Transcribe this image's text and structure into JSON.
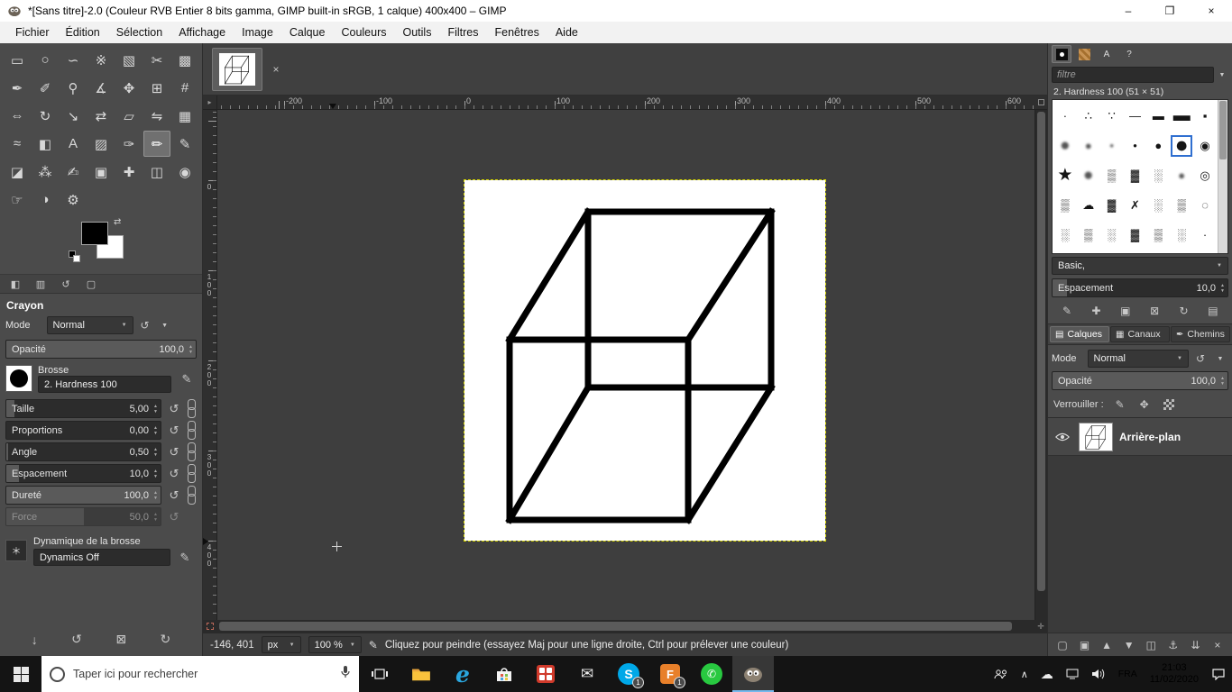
{
  "colors": {
    "selection_accent": "#2f6fd0",
    "layer_boundary_yellow": "#d8d800",
    "canvas_bg": "#ffffff",
    "foreground_color": "#000000",
    "background_color": "#ffffff"
  },
  "icons": {
    "caret_down": "▼",
    "spin_up": "▲",
    "spin_down": "▼",
    "reset": "↺",
    "close": "×",
    "edit": "✎",
    "menu_arrow": "▸",
    "swap": "⇄",
    "corner_menu": "≡",
    "nav_cross": "✛",
    "lock_pixels": "✎",
    "lock_position": "✥",
    "dynamics": "＊",
    "status_tool": "✎",
    "chevron_up": "∧",
    "cloud": "☁",
    "mail": "✉",
    "phone": "✆"
  },
  "window": {
    "title": "*[Sans titre]-2.0 (Couleur RVB Entier 8 bits gamma, GIMP built-in sRGB, 1 calque) 400x400 – GIMP",
    "controls": {
      "minimize": "–",
      "maximize": "❐",
      "close": "×"
    }
  },
  "menu": {
    "items": [
      "Fichier",
      "Édition",
      "Sélection",
      "Affichage",
      "Image",
      "Calque",
      "Couleurs",
      "Outils",
      "Filtres",
      "Fenêtres",
      "Aide"
    ]
  },
  "toolbox": {
    "tools": [
      {
        "n": "rectangle-select-tool",
        "g": "▭"
      },
      {
        "n": "ellipse-select-tool",
        "g": "○"
      },
      {
        "n": "free-select-tool",
        "g": "∽"
      },
      {
        "n": "fuzzy-select-tool",
        "g": "※"
      },
      {
        "n": "select-by-color-tool",
        "g": "▧"
      },
      {
        "n": "scissors-select-tool",
        "g": "✂"
      },
      {
        "n": "foreground-select-tool",
        "g": "▩"
      },
      {
        "n": "paths-tool",
        "g": "✒"
      },
      {
        "n": "color-picker-tool",
        "g": "✐"
      },
      {
        "n": "zoom-tool",
        "g": "⚲"
      },
      {
        "n": "measure-tool",
        "g": "∡"
      },
      {
        "n": "move-tool",
        "g": "✥"
      },
      {
        "n": "align-tool",
        "g": "⊞"
      },
      {
        "n": "crop-tool",
        "g": "#"
      },
      {
        "n": "unified-transform-tool",
        "g": "⇔"
      },
      {
        "n": "rotate-tool",
        "g": "↻"
      },
      {
        "n": "scale-tool",
        "g": "↘"
      },
      {
        "n": "shear-tool",
        "g": "⇄"
      },
      {
        "n": "perspective-tool",
        "g": "▱"
      },
      {
        "n": "flip-tool",
        "g": "⇋"
      },
      {
        "n": "cage-transform-tool",
        "g": "▦"
      },
      {
        "n": "warp-transform-tool",
        "g": "≈"
      },
      {
        "n": "bucket-fill-tool",
        "g": "◧"
      },
      {
        "n": "text-tool",
        "g": "A"
      },
      {
        "n": "gradient-tool",
        "g": "▨"
      },
      {
        "n": "ink-tool",
        "g": "✑"
      },
      {
        "n": "pencil-tool",
        "g": "✏",
        "sel": "sel"
      },
      {
        "n": "paintbrush-tool",
        "g": "✎"
      },
      {
        "n": "eraser-tool",
        "g": "◪"
      },
      {
        "n": "airbrush-tool",
        "g": "⁂"
      },
      {
        "n": "mypaint-brush-tool",
        "g": "✍"
      },
      {
        "n": "clone-tool",
        "g": "▣"
      },
      {
        "n": "heal-tool",
        "g": "✚"
      },
      {
        "n": "perspective-clone-tool",
        "g": "◫"
      },
      {
        "n": "blur-sharpen-tool",
        "g": "◉"
      },
      {
        "n": "smudge-tool",
        "g": "☞"
      },
      {
        "n": "dodge-burn-tool",
        "g": "◑"
      },
      {
        "n": "gegl-operation-tool",
        "g": "⚙"
      }
    ],
    "dock_tabs": [
      {
        "n": "tool-options-tab",
        "g": "◧"
      },
      {
        "n": "device-status-tab",
        "g": "▥"
      },
      {
        "n": "undo-history-tab",
        "g": "↺"
      },
      {
        "n": "images-tab",
        "g": "▢"
      }
    ]
  },
  "tool_options": {
    "title": "Crayon",
    "mode_label": "Mode",
    "mode_value": "Normal",
    "opacity_label": "Opacité",
    "opacity_value": "100,0",
    "brush_label": "Brosse",
    "brush_name": "2. Hardness 100",
    "sliders": [
      {
        "n": "size-slider",
        "label": "Taille",
        "value": "5,00",
        "css": {
          "--w": "5%"
        }
      },
      {
        "n": "aspect-ratio-slider",
        "label": "Proportions",
        "value": "0,00",
        "css": {
          "--w": "0%"
        }
      },
      {
        "n": "angle-slider",
        "label": "Angle",
        "value": "0,50",
        "css": {
          "--w": "1%"
        }
      },
      {
        "n": "spacing-slider",
        "label": "Espacement",
        "value": "10,0",
        "css": {
          "--w": "8%"
        }
      },
      {
        "n": "hardness-slider",
        "label": "Dureté",
        "value": "100,0",
        "css": {
          "--w": "100%"
        }
      },
      {
        "n": "force-slider",
        "label": "Force",
        "value": "50,0",
        "css": {
          "--w": "50%"
        },
        "cls": "dim nochain"
      }
    ],
    "dynamics_label": "Dynamique de la brosse",
    "dynamics_value": "Dynamics Off",
    "footer": [
      {
        "n": "save-tool-preset-button",
        "g": "↓"
      },
      {
        "n": "restore-tool-preset-button",
        "g": "↺"
      },
      {
        "n": "delete-tool-preset-button",
        "g": "⊠"
      },
      {
        "n": "reset-tool-options-button",
        "g": "↻"
      }
    ]
  },
  "canvas": {
    "ruler_h": [
      "-200",
      "-100",
      "0",
      "100",
      "200",
      "300",
      "400",
      "500",
      "600"
    ],
    "ruler_v": [
      "0",
      "100",
      "200",
      "300",
      "400"
    ],
    "cube_lines": [
      [
        137,
        35,
        340,
        35
      ],
      [
        340,
        35,
        340,
        230
      ],
      [
        340,
        230,
        137,
        230
      ],
      [
        137,
        230,
        137,
        35
      ],
      [
        50,
        177,
        248,
        177
      ],
      [
        248,
        177,
        248,
        377
      ],
      [
        248,
        377,
        50,
        377
      ],
      [
        50,
        377,
        50,
        177
      ],
      [
        50,
        177,
        137,
        35
      ],
      [
        248,
        177,
        340,
        35
      ],
      [
        248,
        377,
        340,
        230
      ],
      [
        50,
        377,
        137,
        230
      ]
    ],
    "status": {
      "position": "-146, 401",
      "unit": "px",
      "zoom": "100 %",
      "message": "Cliquez pour peindre (essayez Maj pour une ligne droite, Ctrl pour prélever une couleur)"
    }
  },
  "right_dock": {
    "tab_icons": {
      "fonts": "A",
      "history": "?"
    },
    "filter_placeholder": "filtre",
    "brush_caption": "2. Hardness 100 (51 × 51)",
    "brushes": [
      {
        "g": "·"
      },
      {
        "g": "∴"
      },
      {
        "g": "∵"
      },
      {
        "g": "—"
      },
      {
        "g": "▬"
      },
      {
        "g": "▬",
        "cls": "lg"
      },
      {
        "g": "▪"
      },
      {
        "g": "●",
        "cls": "soft lg"
      },
      {
        "g": "●",
        "cls": "soft"
      },
      {
        "g": "●",
        "cls": "soft sm"
      },
      {
        "g": "●",
        "cls": "sm"
      },
      {
        "g": "●"
      },
      {
        "g": "●",
        "cls": "xl sel"
      },
      {
        "g": "◉"
      },
      {
        "g": "★",
        "cls": "lg"
      },
      {
        "g": "●",
        "cls": "soft lg"
      },
      {
        "g": "▒"
      },
      {
        "g": "▓"
      },
      {
        "g": "░"
      },
      {
        "g": "●",
        "cls": "soft"
      },
      {
        "g": "◎"
      },
      {
        "g": "▒"
      },
      {
        "g": "☁"
      },
      {
        "g": "▓"
      },
      {
        "g": "✗"
      },
      {
        "g": "░"
      },
      {
        "g": "▒"
      },
      {
        "g": "◌"
      },
      {
        "g": "░"
      },
      {
        "g": "▒"
      },
      {
        "g": "░"
      },
      {
        "g": "▓"
      },
      {
        "g": "▒"
      },
      {
        "g": "░"
      },
      {
        "g": "·"
      }
    ],
    "tag_value": "Basic,",
    "spacing": {
      "label": "Espacement",
      "value": "10,0",
      "css": {
        "--w": "8%"
      }
    },
    "brush_actions": [
      {
        "n": "edit-brush-button",
        "g": "✎"
      },
      {
        "n": "new-brush-button",
        "g": "✚"
      },
      {
        "n": "duplicate-brush-button",
        "g": "▣"
      },
      {
        "n": "delete-brush-button",
        "g": "⊠"
      },
      {
        "n": "refresh-brushes-button",
        "g": "↻"
      },
      {
        "n": "open-brush-button",
        "g": "▤"
      }
    ],
    "tabs": [
      {
        "n": "tab-calques",
        "label": "Calques",
        "icon": "▤",
        "sel": "sel"
      },
      {
        "n": "tab-canaux",
        "label": "Canaux",
        "icon": "▦"
      },
      {
        "n": "tab-chemins",
        "label": "Chemins",
        "icon": "✒"
      }
    ],
    "mode": {
      "label": "Mode",
      "value": "Normal"
    },
    "opacity": {
      "label": "Opacité",
      "value": "100,0",
      "css": {
        "--w": "100%"
      }
    },
    "lock_label": "Verrouiller :",
    "layers": [
      {
        "name": "Arrière-plan"
      }
    ],
    "layer_actions": [
      {
        "n": "new-layer-button",
        "g": "▢"
      },
      {
        "n": "new-layer-group-button",
        "g": "▣"
      },
      {
        "n": "raise-layer-button",
        "g": "▲"
      },
      {
        "n": "lower-layer-button",
        "g": "▼"
      },
      {
        "n": "duplicate-layer-button",
        "g": "◫"
      },
      {
        "n": "anchor-layer-button",
        "g": "⚓"
      },
      {
        "n": "merge-down-button",
        "g": "⇊"
      },
      {
        "n": "delete-layer-button",
        "g": "×"
      }
    ]
  },
  "taskbar": {
    "search_placeholder": "Taper ici pour rechercher",
    "apps": {
      "edge_glyph": "e",
      "skype_glyph": "S",
      "f_glyph": "F",
      "badge": "1"
    },
    "tray": {
      "lang": "FRA",
      "time": "21:03",
      "date": "11/02/2020"
    }
  }
}
